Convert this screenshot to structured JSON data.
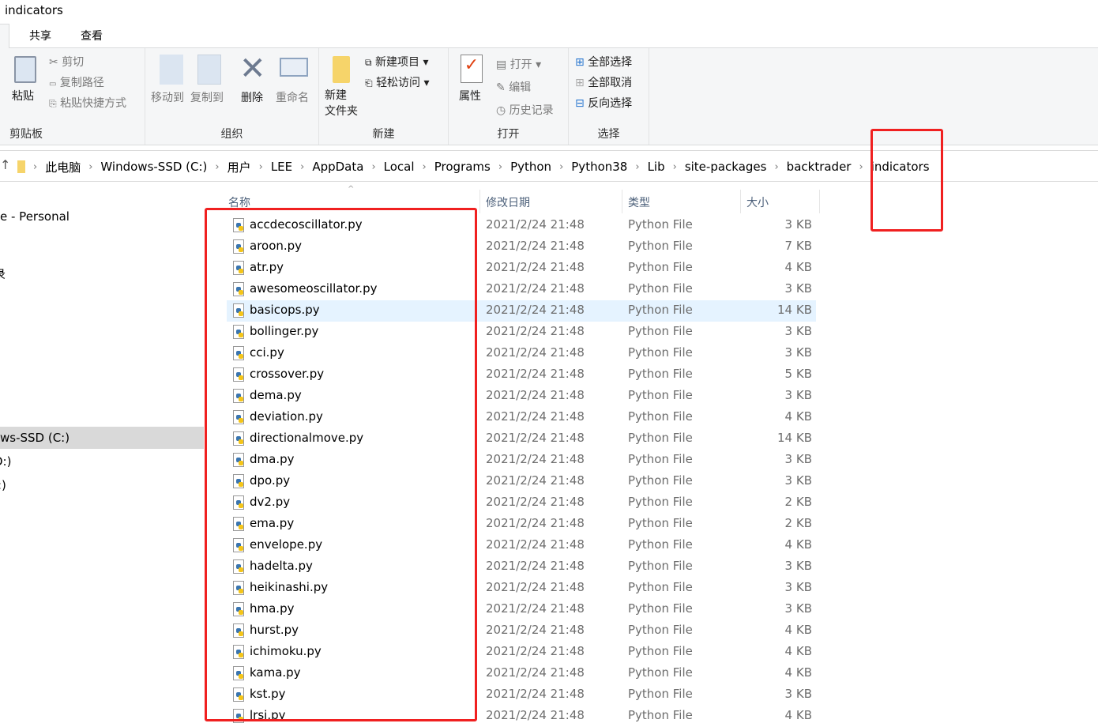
{
  "window": {
    "title": "indicators"
  },
  "tabs": [
    "共享",
    "查看"
  ],
  "ribbon": {
    "clipboard": {
      "label": "剪贴板",
      "paste": "粘贴",
      "cut": "剪切",
      "copy_path": "复制路径",
      "paste_shortcut": "粘贴快捷方式"
    },
    "organize": {
      "label": "组织",
      "move_to": "移动到",
      "copy_to": "复制到",
      "delete": "删除",
      "rename": "重命名"
    },
    "new": {
      "label": "新建",
      "new_folder": "新建\n文件夹",
      "new_item": "新建项目",
      "easy_access": "轻松访问"
    },
    "open": {
      "label": "打开",
      "properties": "属性",
      "open": "打开",
      "edit": "编辑",
      "history": "历史记录"
    },
    "select": {
      "label": "选择",
      "select_all": "全部选择",
      "select_none": "全部取消",
      "invert": "反向选择"
    }
  },
  "breadcrumb": [
    "此电脑",
    "Windows-SSD (C:)",
    "用户",
    "LEE",
    "AppData",
    "Local",
    "Programs",
    "Python",
    "Python38",
    "Lib",
    "site-packages",
    "backtrader",
    "indicators"
  ],
  "sidebar": {
    "items": [
      "e - Personal",
      "录",
      "ws-SSD (C:)",
      "D:)",
      ":)"
    ]
  },
  "columns": {
    "name": "名称",
    "date": "修改日期",
    "type": "类型",
    "size": "大小"
  },
  "files": [
    {
      "name": "accdecoscillator.py",
      "date": "2021/2/24 21:48",
      "type": "Python File",
      "size": "3 KB"
    },
    {
      "name": "aroon.py",
      "date": "2021/2/24 21:48",
      "type": "Python File",
      "size": "7 KB"
    },
    {
      "name": "atr.py",
      "date": "2021/2/24 21:48",
      "type": "Python File",
      "size": "4 KB"
    },
    {
      "name": "awesomeoscillator.py",
      "date": "2021/2/24 21:48",
      "type": "Python File",
      "size": "3 KB"
    },
    {
      "name": "basicops.py",
      "date": "2021/2/24 21:48",
      "type": "Python File",
      "size": "14 KB"
    },
    {
      "name": "bollinger.py",
      "date": "2021/2/24 21:48",
      "type": "Python File",
      "size": "3 KB"
    },
    {
      "name": "cci.py",
      "date": "2021/2/24 21:48",
      "type": "Python File",
      "size": "3 KB"
    },
    {
      "name": "crossover.py",
      "date": "2021/2/24 21:48",
      "type": "Python File",
      "size": "5 KB"
    },
    {
      "name": "dema.py",
      "date": "2021/2/24 21:48",
      "type": "Python File",
      "size": "3 KB"
    },
    {
      "name": "deviation.py",
      "date": "2021/2/24 21:48",
      "type": "Python File",
      "size": "4 KB"
    },
    {
      "name": "directionalmove.py",
      "date": "2021/2/24 21:48",
      "type": "Python File",
      "size": "14 KB"
    },
    {
      "name": "dma.py",
      "date": "2021/2/24 21:48",
      "type": "Python File",
      "size": "3 KB"
    },
    {
      "name": "dpo.py",
      "date": "2021/2/24 21:48",
      "type": "Python File",
      "size": "3 KB"
    },
    {
      "name": "dv2.py",
      "date": "2021/2/24 21:48",
      "type": "Python File",
      "size": "2 KB"
    },
    {
      "name": "ema.py",
      "date": "2021/2/24 21:48",
      "type": "Python File",
      "size": "2 KB"
    },
    {
      "name": "envelope.py",
      "date": "2021/2/24 21:48",
      "type": "Python File",
      "size": "4 KB"
    },
    {
      "name": "hadelta.py",
      "date": "2021/2/24 21:48",
      "type": "Python File",
      "size": "3 KB"
    },
    {
      "name": "heikinashi.py",
      "date": "2021/2/24 21:48",
      "type": "Python File",
      "size": "3 KB"
    },
    {
      "name": "hma.py",
      "date": "2021/2/24 21:48",
      "type": "Python File",
      "size": "3 KB"
    },
    {
      "name": "hurst.py",
      "date": "2021/2/24 21:48",
      "type": "Python File",
      "size": "4 KB"
    },
    {
      "name": "ichimoku.py",
      "date": "2021/2/24 21:48",
      "type": "Python File",
      "size": "4 KB"
    },
    {
      "name": "kama.py",
      "date": "2021/2/24 21:48",
      "type": "Python File",
      "size": "4 KB"
    },
    {
      "name": "kst.py",
      "date": "2021/2/24 21:48",
      "type": "Python File",
      "size": "3 KB"
    },
    {
      "name": "lrsi.py",
      "date": "2021/2/24 21:48",
      "type": "Python File",
      "size": "4 KB"
    }
  ],
  "hover_row": 4,
  "colors": {
    "highlight": "#e5f3ff",
    "annotation": "#f02020",
    "selected_nav": "#d9d9d9"
  }
}
